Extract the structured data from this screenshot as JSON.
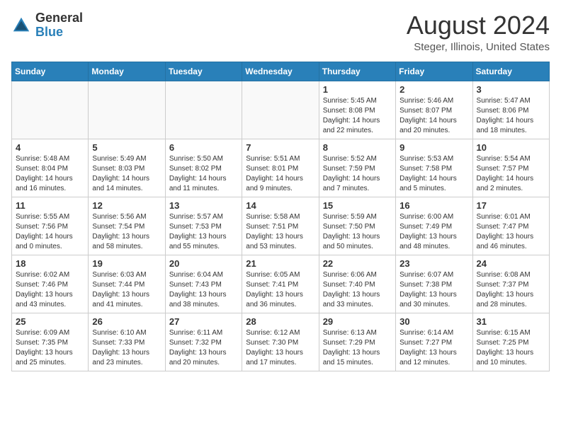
{
  "header": {
    "logo_general": "General",
    "logo_blue": "Blue",
    "month_year": "August 2024",
    "location": "Steger, Illinois, United States"
  },
  "weekdays": [
    "Sunday",
    "Monday",
    "Tuesday",
    "Wednesday",
    "Thursday",
    "Friday",
    "Saturday"
  ],
  "weeks": [
    [
      {
        "day": "",
        "text": ""
      },
      {
        "day": "",
        "text": ""
      },
      {
        "day": "",
        "text": ""
      },
      {
        "day": "",
        "text": ""
      },
      {
        "day": "1",
        "text": "Sunrise: 5:45 AM\nSunset: 8:08 PM\nDaylight: 14 hours\nand 22 minutes."
      },
      {
        "day": "2",
        "text": "Sunrise: 5:46 AM\nSunset: 8:07 PM\nDaylight: 14 hours\nand 20 minutes."
      },
      {
        "day": "3",
        "text": "Sunrise: 5:47 AM\nSunset: 8:06 PM\nDaylight: 14 hours\nand 18 minutes."
      }
    ],
    [
      {
        "day": "4",
        "text": "Sunrise: 5:48 AM\nSunset: 8:04 PM\nDaylight: 14 hours\nand 16 minutes."
      },
      {
        "day": "5",
        "text": "Sunrise: 5:49 AM\nSunset: 8:03 PM\nDaylight: 14 hours\nand 14 minutes."
      },
      {
        "day": "6",
        "text": "Sunrise: 5:50 AM\nSunset: 8:02 PM\nDaylight: 14 hours\nand 11 minutes."
      },
      {
        "day": "7",
        "text": "Sunrise: 5:51 AM\nSunset: 8:01 PM\nDaylight: 14 hours\nand 9 minutes."
      },
      {
        "day": "8",
        "text": "Sunrise: 5:52 AM\nSunset: 7:59 PM\nDaylight: 14 hours\nand 7 minutes."
      },
      {
        "day": "9",
        "text": "Sunrise: 5:53 AM\nSunset: 7:58 PM\nDaylight: 14 hours\nand 5 minutes."
      },
      {
        "day": "10",
        "text": "Sunrise: 5:54 AM\nSunset: 7:57 PM\nDaylight: 14 hours\nand 2 minutes."
      }
    ],
    [
      {
        "day": "11",
        "text": "Sunrise: 5:55 AM\nSunset: 7:56 PM\nDaylight: 14 hours\nand 0 minutes."
      },
      {
        "day": "12",
        "text": "Sunrise: 5:56 AM\nSunset: 7:54 PM\nDaylight: 13 hours\nand 58 minutes."
      },
      {
        "day": "13",
        "text": "Sunrise: 5:57 AM\nSunset: 7:53 PM\nDaylight: 13 hours\nand 55 minutes."
      },
      {
        "day": "14",
        "text": "Sunrise: 5:58 AM\nSunset: 7:51 PM\nDaylight: 13 hours\nand 53 minutes."
      },
      {
        "day": "15",
        "text": "Sunrise: 5:59 AM\nSunset: 7:50 PM\nDaylight: 13 hours\nand 50 minutes."
      },
      {
        "day": "16",
        "text": "Sunrise: 6:00 AM\nSunset: 7:49 PM\nDaylight: 13 hours\nand 48 minutes."
      },
      {
        "day": "17",
        "text": "Sunrise: 6:01 AM\nSunset: 7:47 PM\nDaylight: 13 hours\nand 46 minutes."
      }
    ],
    [
      {
        "day": "18",
        "text": "Sunrise: 6:02 AM\nSunset: 7:46 PM\nDaylight: 13 hours\nand 43 minutes."
      },
      {
        "day": "19",
        "text": "Sunrise: 6:03 AM\nSunset: 7:44 PM\nDaylight: 13 hours\nand 41 minutes."
      },
      {
        "day": "20",
        "text": "Sunrise: 6:04 AM\nSunset: 7:43 PM\nDaylight: 13 hours\nand 38 minutes."
      },
      {
        "day": "21",
        "text": "Sunrise: 6:05 AM\nSunset: 7:41 PM\nDaylight: 13 hours\nand 36 minutes."
      },
      {
        "day": "22",
        "text": "Sunrise: 6:06 AM\nSunset: 7:40 PM\nDaylight: 13 hours\nand 33 minutes."
      },
      {
        "day": "23",
        "text": "Sunrise: 6:07 AM\nSunset: 7:38 PM\nDaylight: 13 hours\nand 30 minutes."
      },
      {
        "day": "24",
        "text": "Sunrise: 6:08 AM\nSunset: 7:37 PM\nDaylight: 13 hours\nand 28 minutes."
      }
    ],
    [
      {
        "day": "25",
        "text": "Sunrise: 6:09 AM\nSunset: 7:35 PM\nDaylight: 13 hours\nand 25 minutes."
      },
      {
        "day": "26",
        "text": "Sunrise: 6:10 AM\nSunset: 7:33 PM\nDaylight: 13 hours\nand 23 minutes."
      },
      {
        "day": "27",
        "text": "Sunrise: 6:11 AM\nSunset: 7:32 PM\nDaylight: 13 hours\nand 20 minutes."
      },
      {
        "day": "28",
        "text": "Sunrise: 6:12 AM\nSunset: 7:30 PM\nDaylight: 13 hours\nand 17 minutes."
      },
      {
        "day": "29",
        "text": "Sunrise: 6:13 AM\nSunset: 7:29 PM\nDaylight: 13 hours\nand 15 minutes."
      },
      {
        "day": "30",
        "text": "Sunrise: 6:14 AM\nSunset: 7:27 PM\nDaylight: 13 hours\nand 12 minutes."
      },
      {
        "day": "31",
        "text": "Sunrise: 6:15 AM\nSunset: 7:25 PM\nDaylight: 13 hours\nand 10 minutes."
      }
    ]
  ]
}
